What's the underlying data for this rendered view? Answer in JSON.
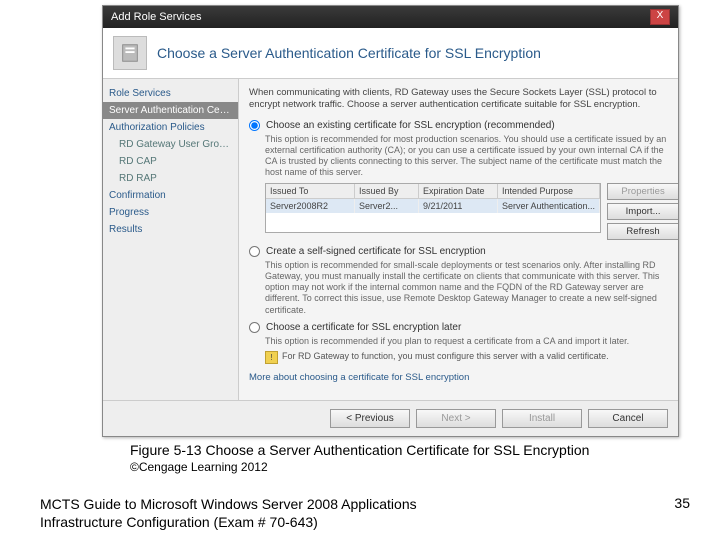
{
  "titlebar": {
    "title": "Add Role Services",
    "close": "X"
  },
  "header": {
    "title": "Choose a Server Authentication Certificate for SSL Encryption"
  },
  "sidebar": {
    "items": [
      {
        "label": "Role Services",
        "active": false,
        "sub": false
      },
      {
        "label": "Server Authentication Certificate",
        "active": true,
        "sub": false
      },
      {
        "label": "Authorization Policies",
        "active": false,
        "sub": false
      },
      {
        "label": "RD Gateway User Groups",
        "active": false,
        "sub": true
      },
      {
        "label": "RD CAP",
        "active": false,
        "sub": true
      },
      {
        "label": "RD RAP",
        "active": false,
        "sub": true
      },
      {
        "label": "Confirmation",
        "active": false,
        "sub": false
      },
      {
        "label": "Progress",
        "active": false,
        "sub": false
      },
      {
        "label": "Results",
        "active": false,
        "sub": false
      }
    ]
  },
  "main": {
    "intro": "When communicating with clients, RD Gateway uses the Secure Sockets Layer (SSL) protocol to encrypt network traffic. Choose a server authentication certificate suitable for SSL encryption.",
    "opt1": {
      "label": "Choose an existing certificate for SSL encryption (recommended)",
      "desc": "This option is recommended for most production scenarios. You should use a certificate issued by an external certification authority (CA); or you can use a certificate issued by your own internal CA if the CA is trusted by clients connecting to this server. The subject name of the certificate must match the host name of this server."
    },
    "table": {
      "h1": "Issued To",
      "h2": "Issued By",
      "h3": "Expiration Date",
      "h4": "Intended Purpose",
      "r1c1": "Server2008R2",
      "r1c2": "Server2...",
      "r1c3": "9/21/2011",
      "r1c4": "Server Authentication..."
    },
    "buttons": {
      "properties": "Properties",
      "import": "Import...",
      "refresh": "Refresh"
    },
    "opt2": {
      "label": "Create a self-signed certificate for SSL encryption",
      "desc": "This option is recommended for small-scale deployments or test scenarios only. After installing RD Gateway, you must manually install the certificate on clients that communicate with this server. This option may not work if the internal common name and the FQDN of the RD Gateway server are different. To correct this issue, use Remote Desktop Gateway Manager to create a new self-signed certificate."
    },
    "opt3": {
      "label": "Choose a certificate for SSL encryption later",
      "desc": "This option is recommended if you plan to request a certificate from a CA and import it later.",
      "warn": "For RD Gateway to function, you must configure this server with a valid certificate."
    },
    "morelink": "More about choosing a certificate for SSL encryption"
  },
  "footer": {
    "previous": "< Previous",
    "next": "Next >",
    "install": "Install",
    "cancel": "Cancel"
  },
  "caption": "Figure 5-13 Choose a Server Authentication Certificate for SSL Encryption",
  "copyright": "©Cengage Learning 2012",
  "guide_line1": "MCTS Guide to Microsoft Windows Server 2008 Applications",
  "guide_line2": "Infrastructure Configuration (Exam # 70-643)",
  "pagenum": "35"
}
